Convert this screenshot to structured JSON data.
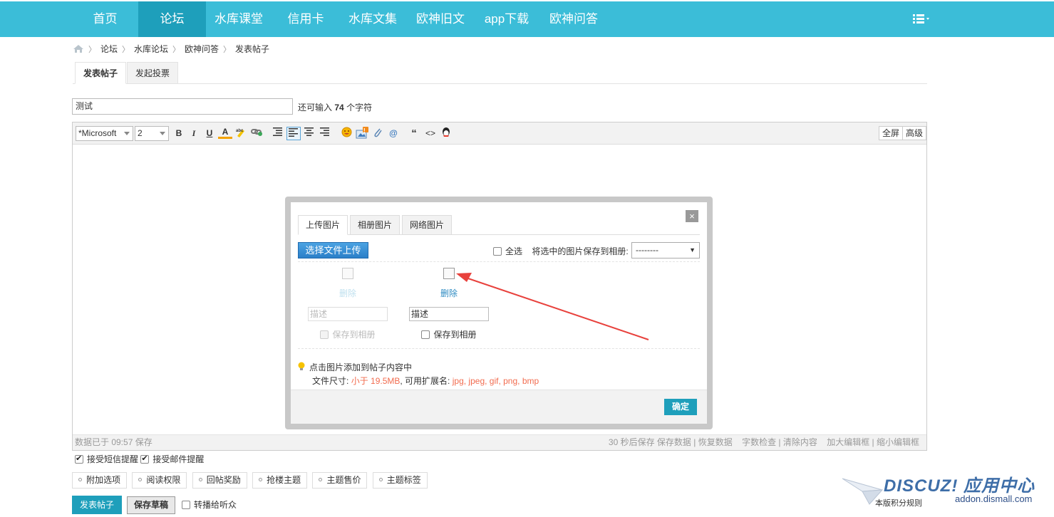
{
  "nav": {
    "items": [
      "首页",
      "论坛",
      "水库课堂",
      "信用卡",
      "水库文集",
      "欧神旧文",
      "app下载",
      "欧神问答"
    ],
    "active_index": 1,
    "menu_icon": "list-menu-icon"
  },
  "breadcrumb": {
    "home_icon": "home-icon",
    "items": [
      "论坛",
      "水库论坛",
      "欧神问答",
      "发表帖子"
    ]
  },
  "post_tabs": [
    "发表帖子",
    "发起投票"
  ],
  "subject": {
    "value": "测试",
    "hint_prefix": "还可输入",
    "hint_count": "74",
    "hint_suffix": "个字符"
  },
  "toolbar": {
    "font_value": "*Microsoft",
    "size_value": "2",
    "buttons": [
      {
        "label": "B",
        "icon": "bold-icon"
      },
      {
        "label": "I",
        "icon": "italic-icon"
      },
      {
        "label": "U",
        "icon": "underline-icon"
      },
      {
        "label": "A",
        "icon": "font-color-icon"
      },
      {
        "label": "",
        "icon": "highlight-icon"
      },
      {
        "label": "",
        "icon": "link-icon"
      },
      {
        "label": "",
        "icon": "float-left-icon"
      },
      {
        "label": "",
        "icon": "align-left-icon"
      },
      {
        "label": "",
        "icon": "align-center-icon"
      },
      {
        "label": "",
        "icon": "align-right-icon"
      },
      {
        "label": "",
        "icon": "smiley-icon"
      },
      {
        "label": "",
        "icon": "image-icon"
      },
      {
        "label": "",
        "icon": "attachment-icon"
      },
      {
        "label": "@",
        "icon": "at-icon"
      },
      {
        "label": "“",
        "icon": "quote-icon"
      },
      {
        "label": "<>",
        "icon": "code-icon"
      },
      {
        "label": "",
        "icon": "qq-icon"
      }
    ],
    "image_badge": "!",
    "fullscreen_label": "全屏",
    "advanced_label": "高级"
  },
  "status_bar": {
    "saved_text": "数据已于 09:57 保存",
    "right_group1": "30 秒后保存 保存数据 | 恢复数据",
    "right_group2": "字数检查 | 清除内容",
    "right_group3": "加大编辑框 | 缩小编辑框"
  },
  "dialog": {
    "tabs": [
      "上传图片",
      "相册图片",
      "网络图片"
    ],
    "close_label": "×",
    "upload_button": "选择文件上传",
    "select_all_label": "全选",
    "save_to_album_label": "将选中的图片保存到相册:",
    "album_select_value": "--------",
    "images": [
      {
        "delete_label": "删除",
        "desc_value": "描述",
        "save_label": "保存到相册",
        "faded": true
      },
      {
        "delete_label": "删除",
        "desc_value": "描述",
        "save_label": "保存到相册",
        "faded": false
      }
    ],
    "hint_line1": "点击图片添加到帖子内容中",
    "hint_size_prefix": "文件尺寸:",
    "hint_size_value": "小于 19.5MB",
    "hint_ext_prefix": ", 可用扩展名:",
    "hint_ext_value": "jpg, jpeg, gif, png, bmp",
    "ok_button": "确定"
  },
  "notify": {
    "sms_label": "接受短信提醒",
    "email_label": "接受邮件提醒",
    "sms_checked": true,
    "email_checked": true
  },
  "options": [
    "附加选项",
    "阅读权限",
    "回帖奖励",
    "抢楼主题",
    "主题售价",
    "主题标签"
  ],
  "actions": {
    "submit_label": "发表帖子",
    "draft_label": "保存草稿",
    "broadcast_label": "转播给听众"
  },
  "rules_link": "本版积分规则",
  "watermark": {
    "brand": "DISCUZ! 应用中心",
    "url": "addon.dismall.com"
  },
  "colors": {
    "nav_bg": "#3bbdd8",
    "nav_active": "#1e9fbb",
    "accent": "#1e9fbb",
    "hint_red": "#f26c4f",
    "arrow": "#e8413c"
  }
}
